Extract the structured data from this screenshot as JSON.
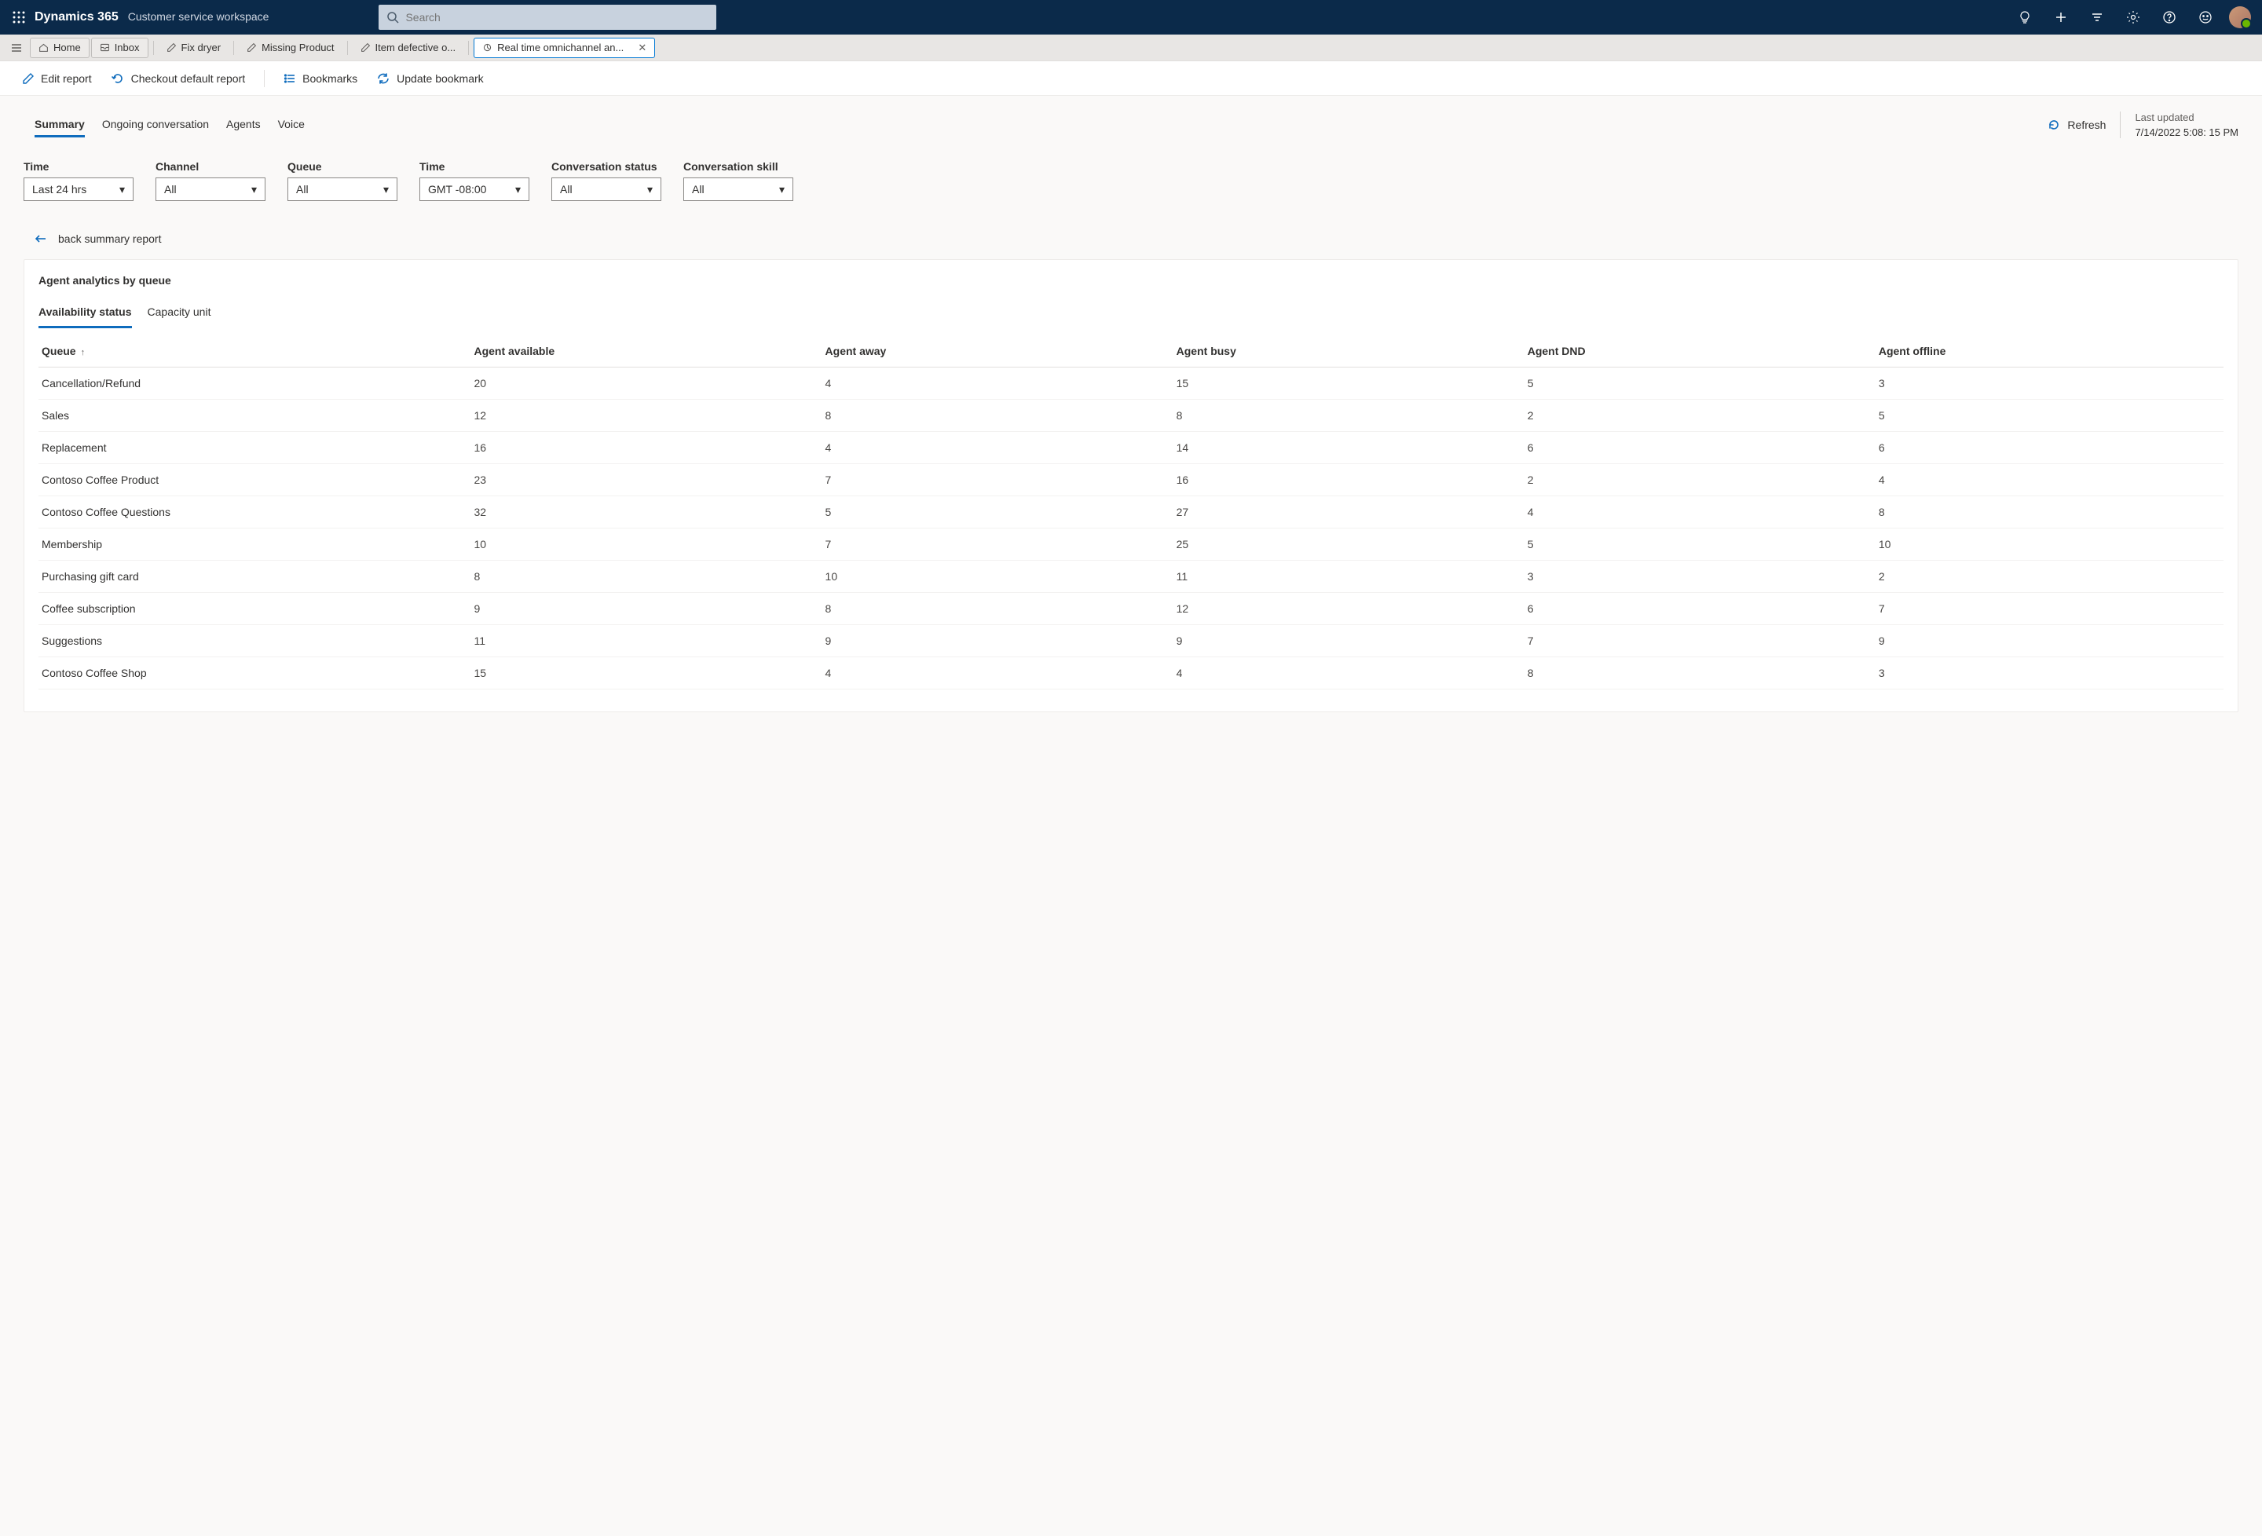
{
  "header": {
    "brand": "Dynamics 365",
    "subtitle": "Customer service workspace",
    "search_placeholder": "Search"
  },
  "tabs": {
    "home": "Home",
    "inbox": "Inbox",
    "items": [
      {
        "label": "Fix dryer"
      },
      {
        "label": "Missing Product"
      },
      {
        "label": "Item defective o..."
      },
      {
        "label": "Real time omnichannel an..."
      }
    ]
  },
  "toolbar": {
    "edit": "Edit report",
    "checkout": "Checkout default report",
    "bookmarks": "Bookmarks",
    "update": "Update bookmark"
  },
  "viewTabs": [
    "Summary",
    "Ongoing conversation",
    "Agents",
    "Voice"
  ],
  "refresh": {
    "label": "Refresh",
    "updated_label": "Last updated",
    "updated_value": "7/14/2022 5:08: 15 PM"
  },
  "filters": [
    {
      "label": "Time",
      "value": "Last 24 hrs"
    },
    {
      "label": "Channel",
      "value": "All"
    },
    {
      "label": "Queue",
      "value": "All"
    },
    {
      "label": "Time",
      "value": "GMT -08:00"
    },
    {
      "label": "Conversation status",
      "value": "All"
    },
    {
      "label": "Conversation skill",
      "value": "All"
    }
  ],
  "back_link": "back summary report",
  "card": {
    "title": "Agent analytics by queue",
    "innerTabs": [
      "Availability status",
      "Capacity unit"
    ],
    "columns": [
      "Queue",
      "Agent available",
      "Agent away",
      "Agent busy",
      "Agent DND",
      "Agent offline"
    ],
    "rows": [
      {
        "queue": "Cancellation/Refund",
        "available": "20",
        "away": "4",
        "busy": "15",
        "dnd": "5",
        "offline": "3"
      },
      {
        "queue": "Sales",
        "available": "12",
        "away": "8",
        "busy": "8",
        "dnd": "2",
        "offline": "5"
      },
      {
        "queue": "Replacement",
        "available": "16",
        "away": "4",
        "busy": "14",
        "dnd": "6",
        "offline": "6"
      },
      {
        "queue": "Contoso Coffee Product",
        "available": "23",
        "away": "7",
        "busy": "16",
        "dnd": "2",
        "offline": "4"
      },
      {
        "queue": "Contoso Coffee Questions",
        "available": "32",
        "away": "5",
        "busy": "27",
        "dnd": "4",
        "offline": "8"
      },
      {
        "queue": "Membership",
        "available": "10",
        "away": "7",
        "busy": "25",
        "dnd": "5",
        "offline": "10"
      },
      {
        "queue": "Purchasing gift card",
        "available": "8",
        "away": "10",
        "busy": "11",
        "dnd": "3",
        "offline": "2"
      },
      {
        "queue": "Coffee subscription",
        "available": "9",
        "away": "8",
        "busy": "12",
        "dnd": "6",
        "offline": "7"
      },
      {
        "queue": "Suggestions",
        "available": "11",
        "away": "9",
        "busy": "9",
        "dnd": "7",
        "offline": "9"
      },
      {
        "queue": "Contoso Coffee Shop",
        "available": "15",
        "away": "4",
        "busy": "4",
        "dnd": "8",
        "offline": "3"
      }
    ]
  }
}
